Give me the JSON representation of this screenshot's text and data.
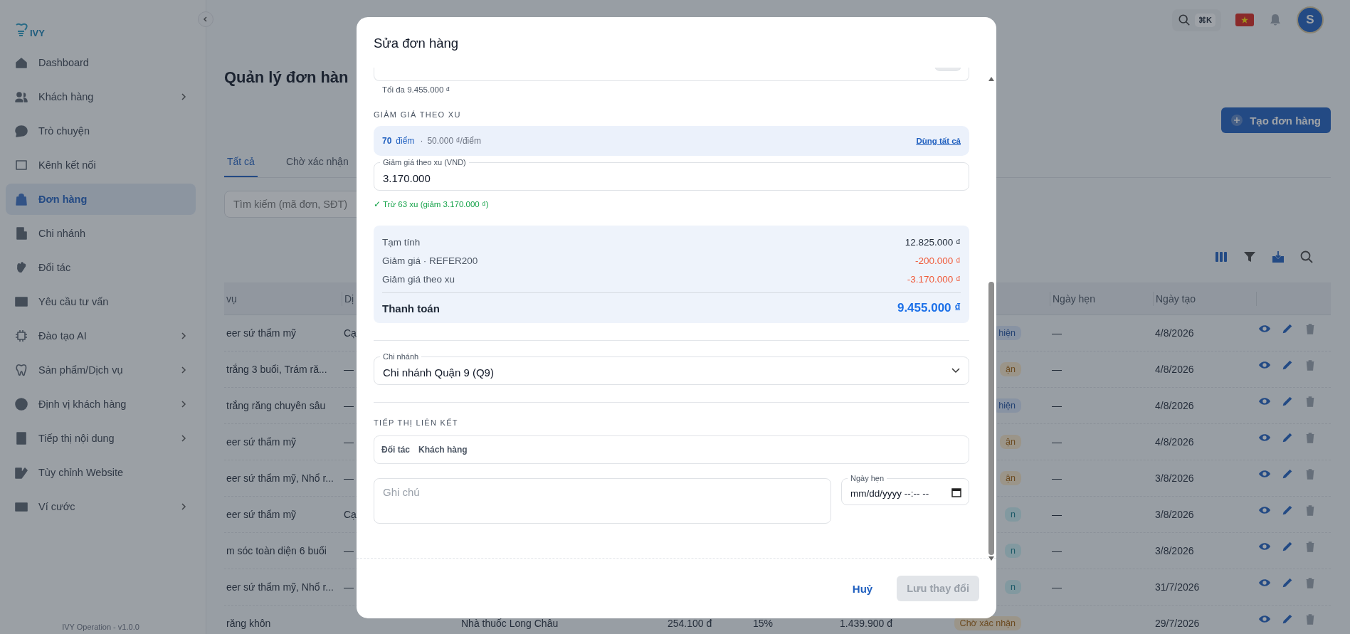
{
  "sidebar": {
    "logo": "IVY",
    "items": [
      {
        "label": "Dashboard",
        "selected": false,
        "has_submenu": false
      },
      {
        "label": "Khách hàng",
        "selected": false,
        "has_submenu": true
      },
      {
        "label": "Trò chuyện",
        "selected": false,
        "has_submenu": false
      },
      {
        "label": "Kênh kết nối",
        "selected": false,
        "has_submenu": false
      },
      {
        "label": "Đơn hàng",
        "selected": true,
        "has_submenu": false
      },
      {
        "label": "Chi nhánh",
        "selected": false,
        "has_submenu": false
      },
      {
        "label": "Đối tác",
        "selected": false,
        "has_submenu": false
      },
      {
        "label": "Yêu cầu tư vấn",
        "selected": false,
        "has_submenu": false
      },
      {
        "label": "Đào tạo AI",
        "selected": false,
        "has_submenu": true
      },
      {
        "label": "Sản phẩm/Dịch vụ",
        "selected": false,
        "has_submenu": true
      },
      {
        "label": "Định vị khách hàng",
        "selected": false,
        "has_submenu": true
      },
      {
        "label": "Tiếp thị nội dung",
        "selected": false,
        "has_submenu": true
      },
      {
        "label": "Tùy chỉnh Website",
        "selected": false,
        "has_submenu": false
      },
      {
        "label": "Ví cước",
        "selected": false,
        "has_submenu": true
      }
    ],
    "footer": "IVY Operation - v1.0.0"
  },
  "topbar": {
    "shortcut": "⌘K",
    "avatar": "S"
  },
  "page": {
    "title": "Quản lý đơn hàn",
    "create_button": "Tạo đơn hàng",
    "tabs": [
      {
        "label": "Tất cả",
        "selected": true
      },
      {
        "label": "Chờ xác nhận",
        "selected": false
      }
    ],
    "search": {
      "placeholder": "Tìm kiếm (mã đơn, SĐT)"
    }
  },
  "table": {
    "header": {
      "column_1": "vụ",
      "column_2": "Dị",
      "appointment": "Ngày hẹn",
      "created": "Ngày tạo"
    },
    "rows": [
      {
        "column_1": "eer sứ thẩm mỹ",
        "column_2": "Cạ",
        "status": {
          "text": "hiện",
          "kind": "info"
        },
        "appointment": "—",
        "created": "4/8/2026"
      },
      {
        "column_1": "trắng 3 buổi, Trám ră...",
        "column_2": "—",
        "status": {
          "text": "ận",
          "kind": "warning"
        },
        "appointment": "—",
        "created": "4/8/2026"
      },
      {
        "column_1": "trắng răng chuyên sâu",
        "column_2": "—",
        "status": {
          "text": "hiện",
          "kind": "info"
        },
        "appointment": "—",
        "created": "4/8/2026"
      },
      {
        "column_1": "eer sứ thẩm mỹ",
        "column_2": "—",
        "status": {
          "text": "ận",
          "kind": "warning"
        },
        "appointment": "—",
        "created": "4/8/2026"
      },
      {
        "column_1": "eer sứ thẩm mỹ, Nhổ r...",
        "column_2": "—",
        "status": {
          "text": "ận",
          "kind": "warning"
        },
        "appointment": "—",
        "created": "3/8/2026"
      },
      {
        "column_1": "eer sứ thẩm mỹ",
        "column_2": "Cạ",
        "status": {
          "text": "n",
          "kind": "success"
        },
        "appointment": "—",
        "created": "3/8/2026"
      },
      {
        "column_1": "m sóc toàn diện 6 buổi",
        "column_2": "—",
        "status": {
          "text": "n",
          "kind": "success"
        },
        "appointment": "—",
        "created": "3/8/2026"
      },
      {
        "column_1": "eer sứ thẩm mỹ, Nhổ r...",
        "column_2": "—",
        "status": {
          "text": "n",
          "kind": "success"
        },
        "appointment": "—",
        "created": "31/7/2026"
      },
      {
        "column_1": "răng khôn",
        "column_3": "Nhà thuốc Long Châu",
        "column_4": "254.100 đ",
        "column_5": "15%",
        "column_6": "1.439.900 đ",
        "status": {
          "text": "Chờ xác nhận",
          "kind": "warning"
        },
        "created": "29/7/2026"
      }
    ]
  },
  "modal": {
    "title": "Sửa đơn hàng",
    "max_hint": "Tối đa 9.455.000 ₫",
    "coin_section": {
      "heading": "GIẢM GIÁ THEO XU",
      "points": "70",
      "points_unit": "điểm",
      "separator": "·",
      "rate": "50.000 ₫/điểm",
      "use_all": "Dùng tất cả",
      "field_label": "Giảm giá theo xu (VND)",
      "field_value": "3.170.000",
      "confirmation": "✓ Trừ 63 xu (giảm 3.170.000 ₫)"
    },
    "summary": {
      "lines": [
        {
          "label": "Tạm tính",
          "value": "12.825.000 ₫",
          "kind": "subtotal"
        },
        {
          "label": "Giảm giá · REFER200",
          "value": "-200.000 ₫",
          "kind": "discount"
        },
        {
          "label": "Giảm giá theo xu",
          "value": "-3.170.000 ₫",
          "kind": "discount"
        }
      ],
      "total_label": "Thanh toán",
      "total_value": "9.455.000 ₫"
    },
    "branch": {
      "label": "Chi nhánh",
      "value": "Chi nhánh Quận 9 (Q9)"
    },
    "affiliate": {
      "heading": "TIẾP THỊ LIÊN KẾT",
      "options": [
        {
          "label": "Đối tác",
          "selected": false
        },
        {
          "label": "Khách hàng",
          "selected": false
        }
      ]
    },
    "note": {
      "placeholder": "Ghi chú"
    },
    "appointment": {
      "label": "Ngày hẹn",
      "value": "mm/dd/yyyy --:-- --"
    },
    "cancel": "Huỷ",
    "save": {
      "label": "Lưu thay đổi",
      "disabled": true
    }
  }
}
